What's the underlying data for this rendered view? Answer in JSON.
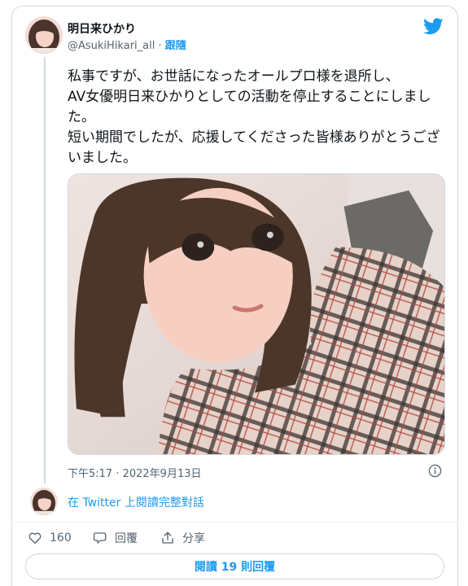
{
  "author": {
    "display_name": "明日来ひかり",
    "handle": "@AsukiHikari_all",
    "separator": " · ",
    "follow_label": "跟隨"
  },
  "tweet": {
    "text": "私事ですが、お世話になったオールプロ様を退所し、\nAV女優明日来ひかりとしての活動を停止することにしました。\n短い期間でしたが、応援してくださった皆様ありがとうございました。",
    "timestamp": "下午5:17 · 2022年9月13日"
  },
  "thread": {
    "read_full_label": "在 Twitter 上閱讀完整對話"
  },
  "actions": {
    "like_count": "160",
    "reply_label": "回覆",
    "share_label": "分享"
  },
  "replies_button": {
    "label": "閱讀 19 則回覆"
  },
  "colors": {
    "accent": "#1d9bf0",
    "text_primary": "#0f1419",
    "text_secondary": "#536471",
    "border": "#cfd9de"
  },
  "icons": {
    "logo": "twitter-bird-icon",
    "info": "info-icon",
    "like": "heart-icon",
    "reply": "speech-bubble-icon",
    "share": "share-upload-icon"
  }
}
